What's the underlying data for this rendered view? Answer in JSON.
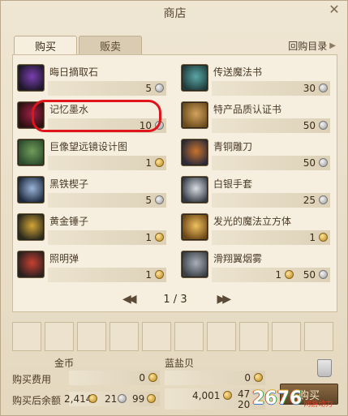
{
  "window": {
    "title": "商店",
    "close_glyph": "✕"
  },
  "tabs": [
    {
      "label": "购买"
    },
    {
      "label": "贩卖"
    }
  ],
  "buyback": {
    "label": "回购目录",
    "glyph": "▶"
  },
  "items": [
    {
      "name": "晦日摘取石",
      "price": "5",
      "currency": "silver",
      "colors": [
        "#1c1628",
        "#7b3fb0"
      ]
    },
    {
      "name": "传送魔法书",
      "price": "30",
      "currency": "silver",
      "colors": [
        "#1e3a3a",
        "#5aa6a6"
      ]
    },
    {
      "name": "记忆墨水",
      "price": "10",
      "currency": "silver",
      "colors": [
        "#2a1010",
        "#a32045"
      ]
    },
    {
      "name": "特产品质认证书",
      "price": "50",
      "currency": "silver",
      "colors": [
        "#6a4a1c",
        "#d3a35c"
      ]
    },
    {
      "name": "巨像望远镜设计图",
      "price": "1",
      "currency": "gold",
      "colors": [
        "#2c4a2c",
        "#6f9c5a"
      ]
    },
    {
      "name": "青铜雕刀",
      "price": "50",
      "currency": "silver",
      "colors": [
        "#2a2a3a",
        "#c9732e"
      ]
    },
    {
      "name": "黑铁楔子",
      "price": "5",
      "currency": "silver",
      "colors": [
        "#1e2a3e",
        "#9ab4d8"
      ]
    },
    {
      "name": "白银手套",
      "price": "25",
      "currency": "silver",
      "colors": [
        "#343a44",
        "#d8dde3"
      ]
    },
    {
      "name": "黄金锤子",
      "price": "1",
      "currency": "gold",
      "colors": [
        "#2a2a1c",
        "#d4a437"
      ]
    },
    {
      "name": "发光的魔法立方体",
      "price": "1",
      "currency": "gold",
      "colors": [
        "#6a4414",
        "#f0c060"
      ]
    },
    {
      "name": "照明弹",
      "price": "1",
      "currency": "gold",
      "colors": [
        "#2a2020",
        "#c84030"
      ]
    },
    {
      "name": "滑翔翼烟雾",
      "price_gold": "1",
      "price_silver": "50",
      "colors": [
        "#3a3f46",
        "#aab0b8"
      ]
    }
  ],
  "pager": {
    "prev_glyph": "◀◀",
    "page": "1 / 3",
    "next_glyph": "▶▶"
  },
  "currency": {
    "gold_label": "金币",
    "shell_label": "蓝盐贝",
    "cost_label": "购买费用",
    "balance_label": "购买后余额",
    "cost_gold": "0",
    "cost_shell": "0",
    "balance_gold": "2,414",
    "balance_silver": "21",
    "balance_copper": "99",
    "balance_shell_a": "4,001",
    "balance_shell_b": "47",
    "balance_shell_c": "20"
  },
  "buy_button": {
    "label": "购买"
  },
  "watermark": {
    "text": "2676",
    "sub": "网游动力"
  }
}
